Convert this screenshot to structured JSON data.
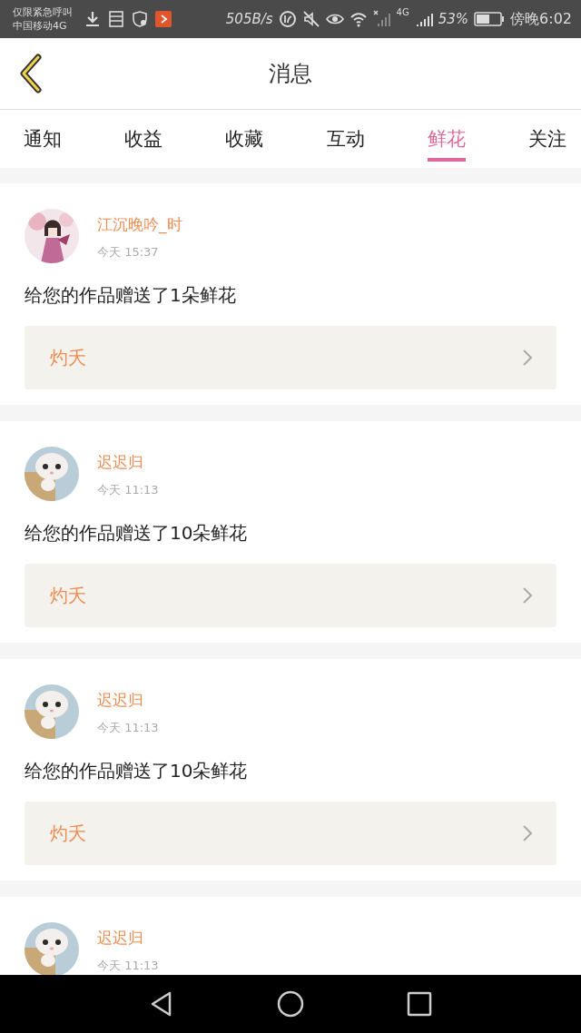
{
  "status_bar": {
    "carrier_top": "仅限紧急呼叫",
    "carrier_bottom": "中国移动4G",
    "speed": "505B/s",
    "network": "4G",
    "battery": "53%",
    "time": "傍晚6:02"
  },
  "header": {
    "title": "消息"
  },
  "tabs": [
    {
      "label": "通知",
      "selected": false
    },
    {
      "label": "收益",
      "selected": false
    },
    {
      "label": "收藏",
      "selected": false
    },
    {
      "label": "互动",
      "selected": false
    },
    {
      "label": "鲜花",
      "selected": true
    },
    {
      "label": "关注",
      "selected": false
    }
  ],
  "messages": [
    {
      "name": "江沉晚吟_时",
      "time": "今天  15:37",
      "text": "给您的作品赠送了1朵鲜花",
      "work": "灼夭"
    },
    {
      "name": "迟迟归",
      "time": "今天  11:13",
      "text": "给您的作品赠送了10朵鲜花",
      "work": "灼夭"
    },
    {
      "name": "迟迟归",
      "time": "今天  11:13",
      "text": "给您的作品赠送了10朵鲜花",
      "work": "灼夭"
    },
    {
      "name": "迟迟归",
      "time": "今天  11:13"
    }
  ]
}
